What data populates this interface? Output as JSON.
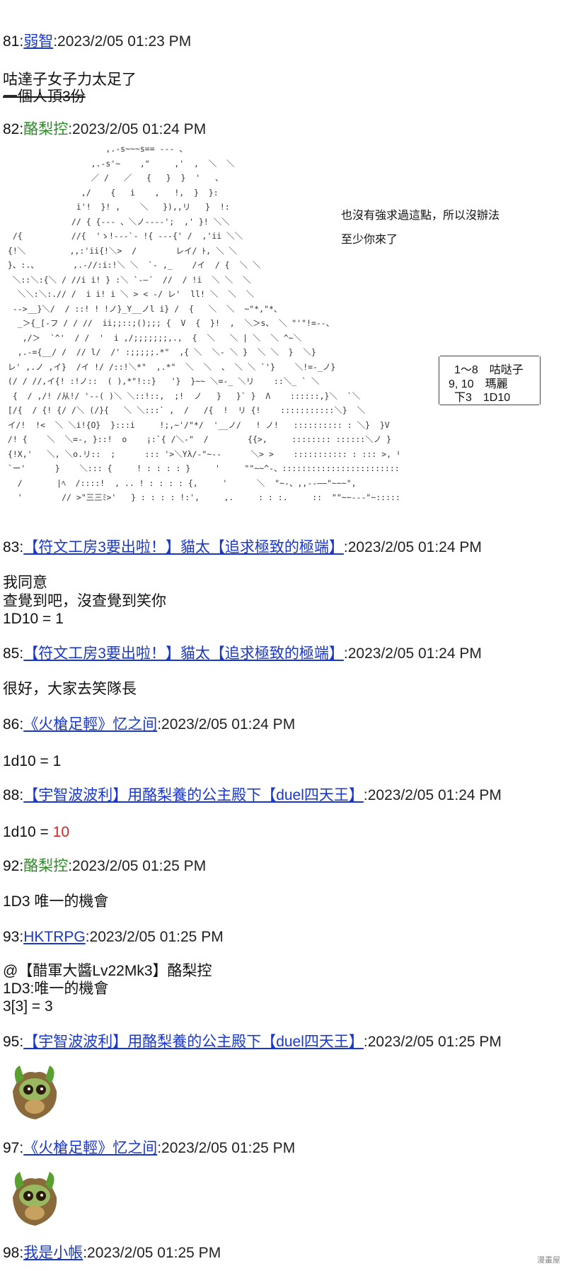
{
  "posts": [
    {
      "num": "81:",
      "name": "弱智",
      "time": ":2023/2/05 01:23 PM"
    },
    {
      "num": "82:",
      "name": "酪梨控",
      "time": ":2023/2/05 01:24 PM"
    },
    {
      "num": "83:",
      "name": "【符文工房3要出啦！】貓太【追求極致的極端】",
      "time": ":2023/2/05 01:24 PM"
    },
    {
      "num": "85:",
      "name": "【符文工房3要出啦！】貓太【追求極致的極端】",
      "time": ":2023/2/05 01:24 PM"
    },
    {
      "num": "86:",
      "name": "《火槍足輕》忆之间",
      "time": ":2023/2/05 01:24 PM"
    },
    {
      "num": "88:",
      "name": "【宇智波波利】用酪梨養的公主殿下【duel四天王】",
      "time": ":2023/2/05 01:24 PM"
    },
    {
      "num": "92:",
      "name": "酪梨控",
      "time": ":2023/2/05 01:25 PM"
    },
    {
      "num": "93:",
      "name": "HKTRPG",
      "time": ":2023/2/05 01:25 PM"
    },
    {
      "num": "95:",
      "name": "【宇智波波利】用酪梨養的公主殿下【duel四天王】",
      "time": ":2023/2/05 01:25 PM"
    },
    {
      "num": "97:",
      "name": "《火槍足輕》忆之间",
      "time": ":2023/2/05 01:25 PM"
    },
    {
      "num": "98:",
      "name": "我是小帳",
      "time": ":2023/2/05 01:25 PM"
    }
  ],
  "bodies": {
    "p81_line1": "咕達子女子力太足了",
    "p81_line2": "一個人頂3份",
    "p82_note1": "也沒有強求過這點，所以沒辦法",
    "p82_note2": "至少你來了",
    "p82_roll1": "1～8　咕哒子",
    "p82_roll2": "9, 10　瑪麗",
    "p82_roll3": "下3　1D10",
    "p83_line1": "我同意",
    "p83_line2": "查覺到吧，沒查覺到笑你",
    "p83_line3": "1D10 = 1",
    "p85_line1": "很好，大家去笑隊長",
    "p86_line1": "1d10 = 1",
    "p88_prefix": "1d10 = ",
    "p88_value": "10",
    "p92_line1": "1D3 唯一的機會",
    "p93_line1": "@【醋軍大醬Lv22Mk3】酪梨控",
    "p93_line2": "1D3:唯一的機會",
    "p93_line3": "3[3] = 3"
  },
  "watermark": "漫畫屋",
  "colors": {
    "link": "#1a37cc",
    "plain_name": "#2f8a2a",
    "highlight": "#d22525"
  }
}
